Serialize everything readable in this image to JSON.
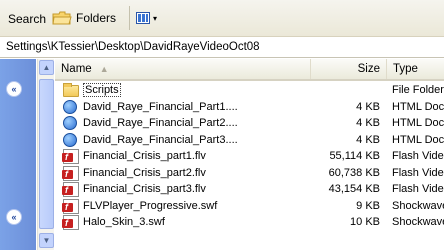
{
  "toolbar": {
    "search_label": "Search",
    "folders_label": "Folders",
    "views_icon": "views-grid-icon"
  },
  "address": {
    "path": "Settings\\KTessier\\Desktop\\DavidRayeVideoOct08"
  },
  "columns": {
    "name": "Name",
    "size": "Size",
    "type": "Type"
  },
  "files": [
    {
      "name": "Scripts",
      "size": "",
      "type": "File Folder",
      "icon": "folder-icon"
    },
    {
      "name": "David_Raye_Financial_Part1....",
      "size": "4 KB",
      "type": "HTML Document",
      "icon": "html-document-icon"
    },
    {
      "name": "David_Raye_Financial_Part2....",
      "size": "4 KB",
      "type": "HTML Document",
      "icon": "html-document-icon"
    },
    {
      "name": "David_Raye_Financial_Part3....",
      "size": "4 KB",
      "type": "HTML Document",
      "icon": "html-document-icon"
    },
    {
      "name": "Financial_Crisis_part1.flv",
      "size": "55,114 KB",
      "type": "Flash Video File",
      "icon": "flash-video-icon"
    },
    {
      "name": "Financial_Crisis_part2.flv",
      "size": "60,738 KB",
      "type": "Flash Video File",
      "icon": "flash-video-icon"
    },
    {
      "name": "Financial_Crisis_part3.flv",
      "size": "43,154 KB",
      "type": "Flash Video File",
      "icon": "flash-video-icon"
    },
    {
      "name": "FLVPlayer_Progressive.swf",
      "size": "9 KB",
      "type": "Shockwave Flash O",
      "icon": "shockwave-flash-icon"
    },
    {
      "name": "Halo_Skin_3.swf",
      "size": "10 KB",
      "type": "Shockwave Flash O",
      "icon": "shockwave-flash-icon"
    }
  ]
}
